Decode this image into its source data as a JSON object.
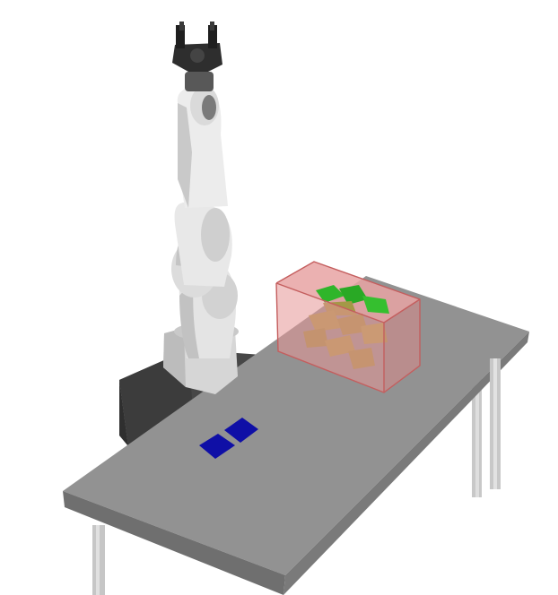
{
  "scene": {
    "background": "#ffffff",
    "colors": {
      "table_top": "#8f8f8f",
      "table_edge": "#6e6e6e",
      "table_leg": "#c4c4c4",
      "pedestal": "#4a4a4a",
      "pedestal_dark": "#3a3a3a",
      "robot_body": "#e2e2e2",
      "robot_shadow": "#b9b9b9",
      "robot_joint": "#5a5a5a",
      "gripper": "#2d2d2d",
      "bin_fill": "#e59a9a",
      "bin_edge": "#c25b5b",
      "item_green": "#2fb52a",
      "item_olive": "#a99a48",
      "target_tile": "#0d0da8"
    },
    "objects": [
      {
        "name": "work-table",
        "icon": "table"
      },
      {
        "name": "robot-pedestal",
        "icon": "cube"
      },
      {
        "name": "robot-arm",
        "icon": "robot-arm"
      },
      {
        "name": "transparent-bin",
        "icon": "bin"
      },
      {
        "name": "bin-items",
        "icon": "scatter-pieces"
      },
      {
        "name": "blue-target-tiles",
        "icon": "square-markers"
      }
    ]
  }
}
